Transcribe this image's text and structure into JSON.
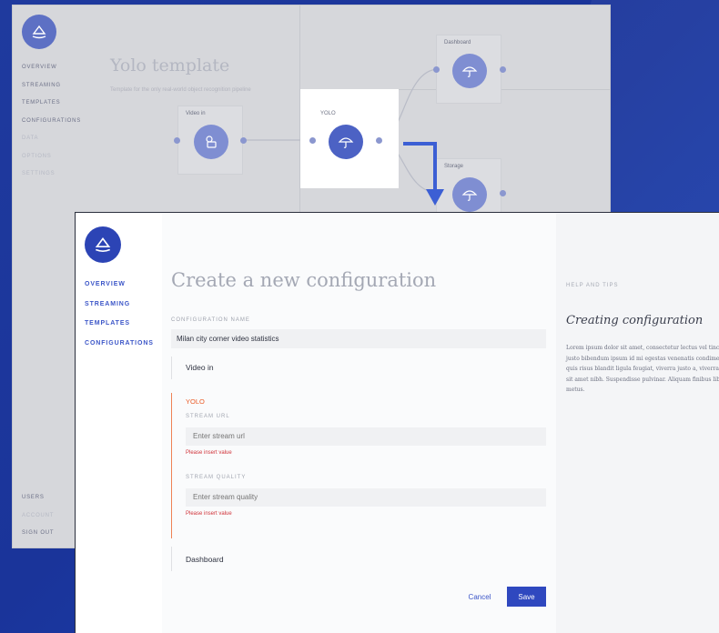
{
  "back_window": {
    "nav": [
      "OVERVIEW",
      "STREAMING",
      "TEMPLATES",
      "CONFIGURATIONS",
      "DATA",
      "OPTIONS",
      "SETTINGS"
    ],
    "nav_bottom": [
      "USERS",
      "ACCOUNT",
      "SIGN OUT"
    ],
    "title": "Yolo template",
    "subtitle": "Template for the only real-world object recognition pipeline",
    "nodes": {
      "video_in": "Video in",
      "yolo": "YOLO",
      "dashboard": "Dashboard",
      "storage": "Storage"
    }
  },
  "front_window": {
    "nav": [
      "OVERVIEW",
      "STREAMING",
      "TEMPLATES",
      "CONFIGURATIONS"
    ],
    "page_title": "Create a new configuration",
    "config_name_label": "CONFIGURATION NAME",
    "config_name_value": "Milan city corner video statistics",
    "sections": {
      "video_in": "Video in",
      "yolo": "YOLO",
      "dashboard": "Dashboard"
    },
    "fields": {
      "stream_url_label": "STREAM URL",
      "stream_url_placeholder": "Enter stream url",
      "stream_url_error": "Please insert value",
      "stream_quality_label": "STREAM QUALITY",
      "stream_quality_placeholder": "Enter stream quality",
      "stream_quality_error": "Please insert value"
    },
    "buttons": {
      "cancel": "Cancel",
      "save": "Save"
    },
    "help": {
      "heading": "HELP AND TIPS",
      "title": "Creating configuration",
      "body": "Lorem ipsum dolor sit amet, consectetur lectus vel tincidunt. Vivamus sed justo bibendum ipsum id mi egestas venenatis condimentum. Phasellus quis risus blandit ligula feugiat, viverra justo a, viverra ipsum eu, ultrices sit amet nibh. Suspendisse pulvinar. Aliquam finibus libero nisl, vitae arcu metus."
    }
  },
  "colors": {
    "background": "#1f3a9e",
    "accent": "#2f48bf",
    "error": "#d0343b",
    "active_section": "#ea5a25"
  }
}
